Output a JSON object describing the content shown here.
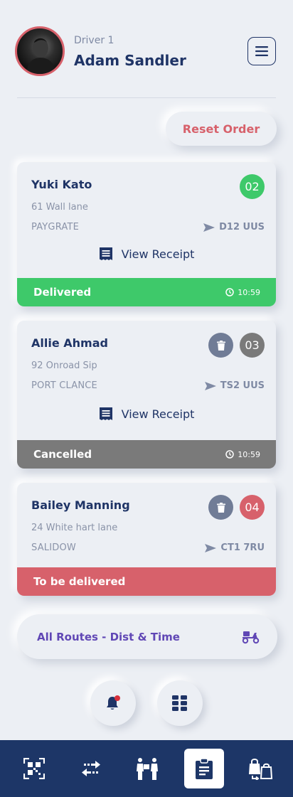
{
  "header": {
    "driver_label": "Driver 1",
    "driver_name": "Adam Sandler"
  },
  "reset_label": "Reset Order",
  "orders": [
    {
      "name": "Yuki Kato",
      "address": "61 Wall lane",
      "city": "PAYGRATE",
      "postcode": "D12 UUS",
      "number": "02",
      "receipt_label": "View Receipt",
      "status": "Delivered",
      "time": "10:59",
      "status_color": "#3ec96a",
      "badge_color": "#3ec96a"
    },
    {
      "name": "Allie Ahmad",
      "address": "92 Onroad Sip",
      "city": "PORT CLANCE",
      "postcode": "TS2 UUS",
      "number": "03",
      "receipt_label": "View Receipt",
      "status": "Cancelled",
      "time": "10:59",
      "status_color": "#7a7a7a",
      "badge_color": "#7a7a7a"
    },
    {
      "name": "Bailey Manning",
      "address": "24 White hart lane",
      "city": "SALIDOW",
      "postcode": "CT1 7RU",
      "number": "04",
      "status": "To be delivered",
      "status_color": "#d7616b",
      "badge_color": "#d7616b"
    }
  ],
  "routes_label": "All Routes - Dist & Time",
  "colors": {
    "accent_text": "#1f3466",
    "nav_bg": "#1d3667",
    "routes_purple": "#6047b5"
  },
  "icons": {
    "menu": "hamburger-icon",
    "send": "send-icon",
    "receipt": "receipt-icon",
    "clock": "clock-icon",
    "trash": "trash-icon",
    "scooter": "delivery-scooter-icon",
    "bell": "bell-icon",
    "grid": "grid-icon",
    "nav": [
      "qr-scan-icon",
      "transfer-icon",
      "handover-icon",
      "clipboard-icon",
      "shopping-return-icon"
    ]
  }
}
